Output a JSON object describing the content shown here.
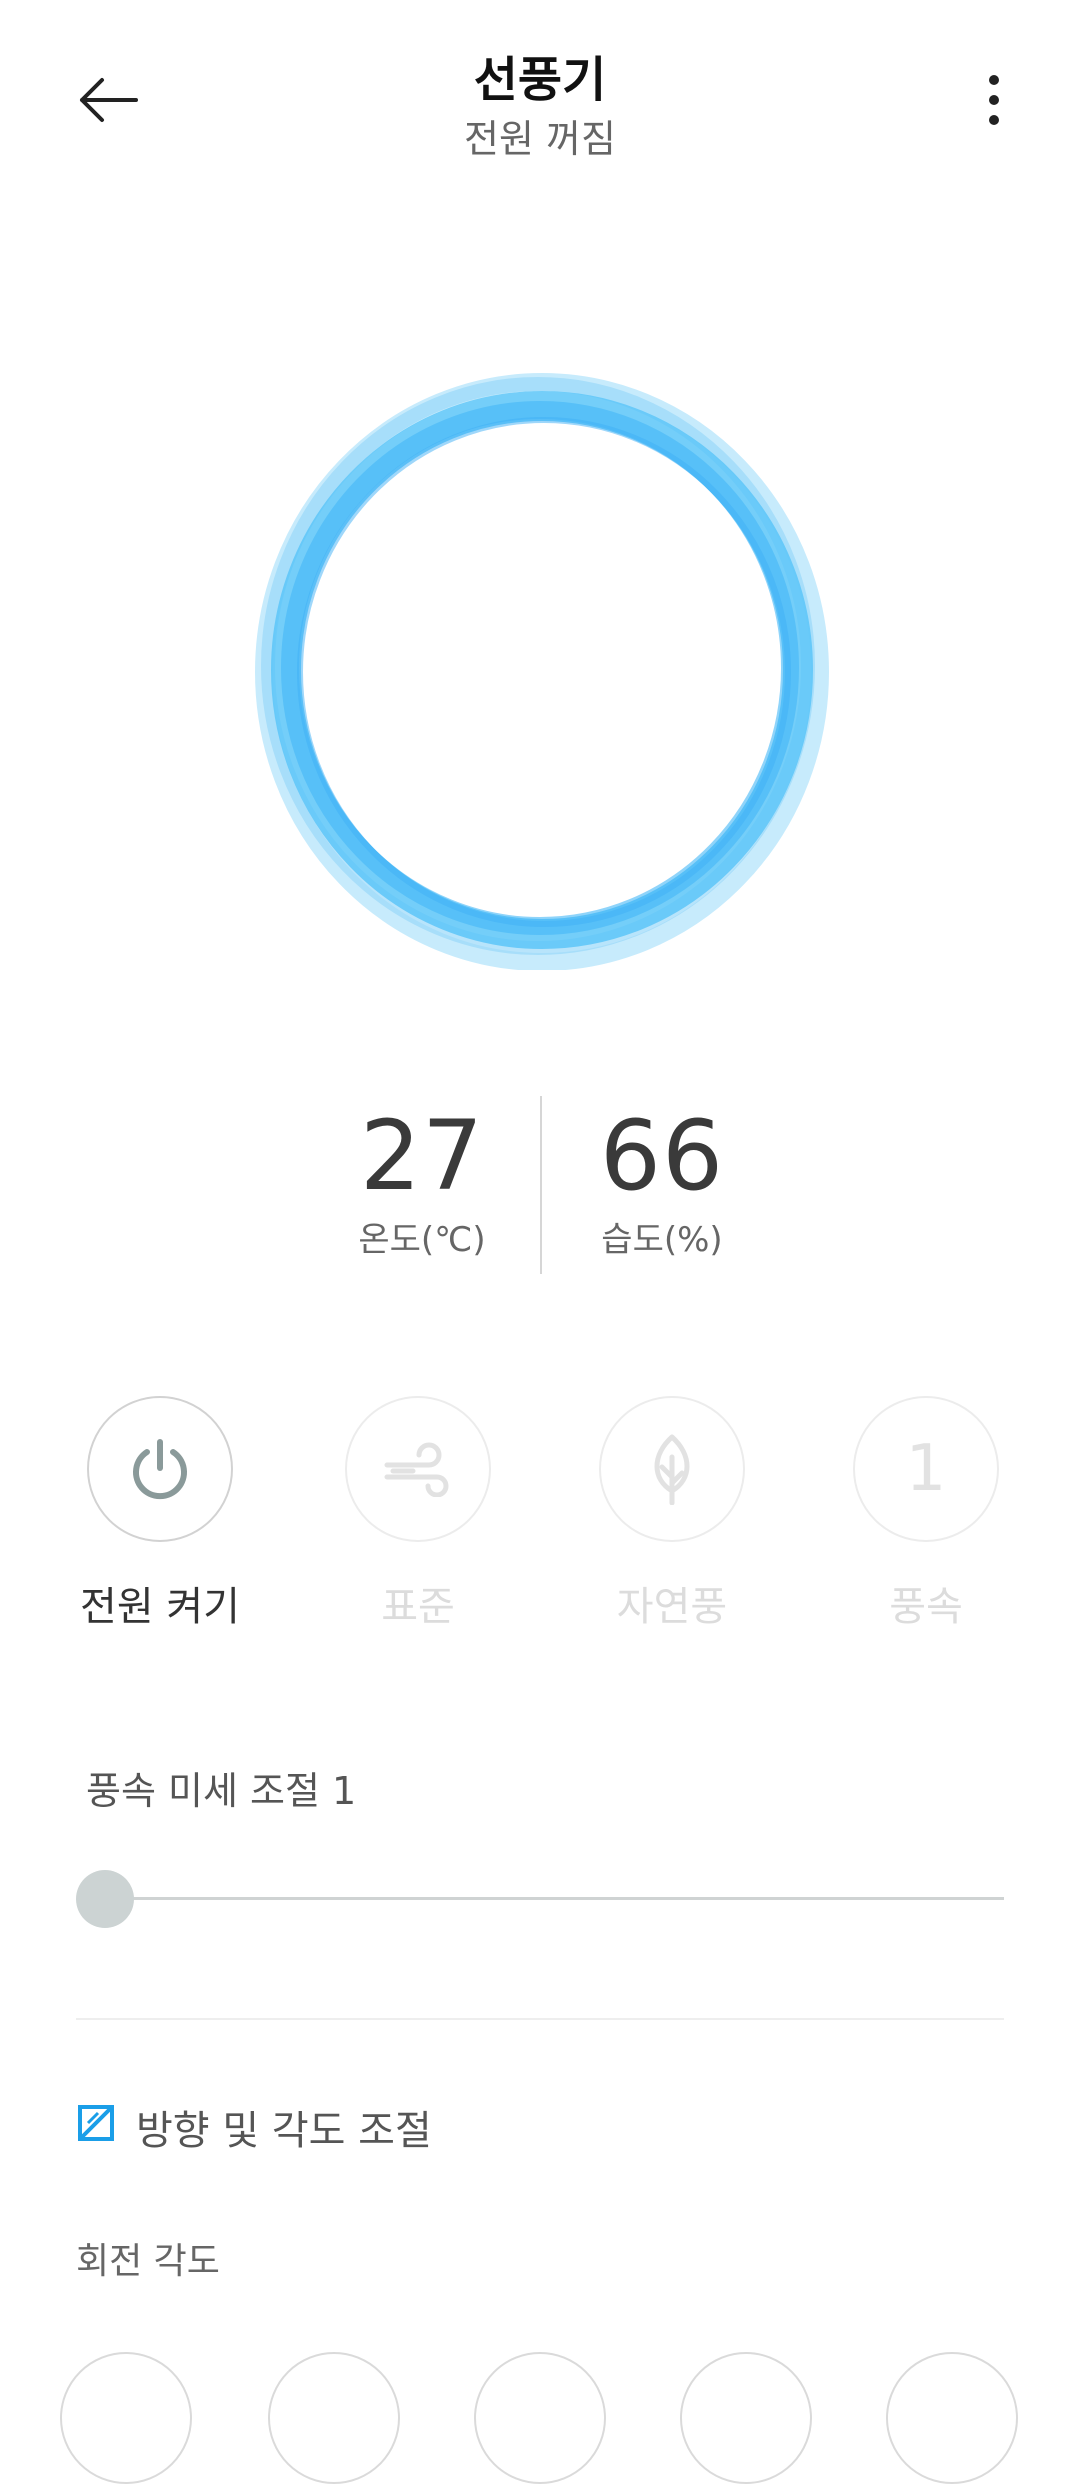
{
  "header": {
    "title": "선풍기",
    "subtitle": "전원 꺼짐",
    "back_icon": "back-arrow-icon",
    "more_icon": "more-vertical-icon"
  },
  "readings": {
    "temperature": {
      "value": "27",
      "label": "온도(℃)"
    },
    "humidity": {
      "value": "66",
      "label": "습도(%)"
    }
  },
  "modes": [
    {
      "label": "전원 켜기",
      "icon": "power-icon",
      "state": "active"
    },
    {
      "label": "표준",
      "icon": "wind-icon",
      "state": "disabled"
    },
    {
      "label": "자연풍",
      "icon": "leaf-icon",
      "state": "disabled"
    },
    {
      "label": "풍속",
      "icon_text": "1",
      "state": "disabled"
    }
  ],
  "speed": {
    "label": "풍속 미세 조절 1",
    "level": 0
  },
  "direction": {
    "label": "방향 및 각도 조절",
    "icon": "angle-adjust-icon",
    "rotation_label": "회전 각도"
  },
  "colors": {
    "accent": "#1a9ee8",
    "ring": "#4fc3f7",
    "disabled": "#dcdcdc"
  }
}
